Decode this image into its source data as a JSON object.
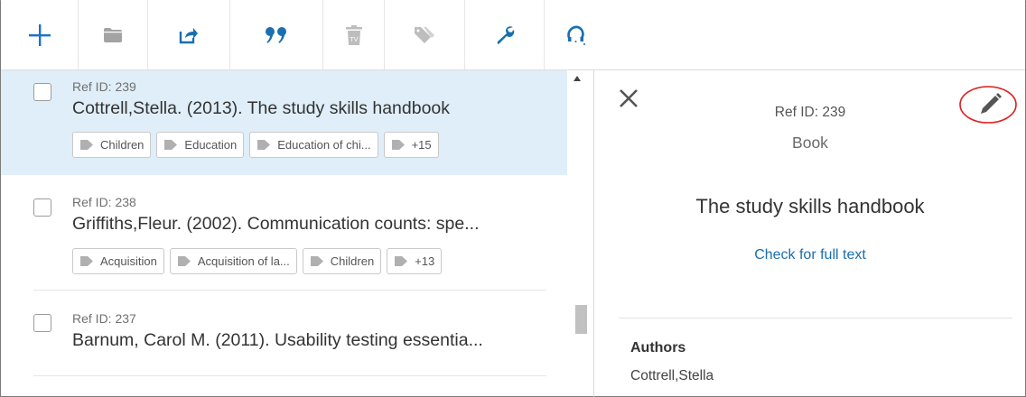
{
  "toolbar": {
    "buttons": [
      {
        "name": "add-icon",
        "color": "#1a73c8"
      },
      {
        "name": "folder-icon",
        "color": "#9e9e9e"
      },
      {
        "name": "share-icon",
        "color": "#1a6fb0"
      },
      {
        "name": "quote-icon",
        "color": "#1a6fb0"
      },
      {
        "name": "trash-icon",
        "color": "#b9b9b9"
      },
      {
        "name": "tag-icon",
        "color": "#b9b9b9"
      },
      {
        "name": "wrench-icon",
        "color": "#1a6fb0"
      },
      {
        "name": "find-duplicates-icon",
        "color": "#1a6fb0"
      }
    ]
  },
  "list": {
    "items": [
      {
        "ref_id": "Ref ID: 239",
        "title": "Cottrell,Stella. (2013). The study skills handbook",
        "selected": true,
        "tags": [
          "Children",
          "Education",
          "Education of chi...",
          "+15"
        ]
      },
      {
        "ref_id": "Ref ID: 238",
        "title": "Griffiths,Fleur. (2002). Communication counts: spe...",
        "selected": false,
        "tags": [
          "Acquisition",
          "Acquisition of la...",
          "Children",
          "+13"
        ]
      },
      {
        "ref_id": "Ref ID: 237",
        "title": "Barnum, Carol M. (2011). Usability testing essentia...",
        "selected": false,
        "tags": []
      }
    ]
  },
  "detail": {
    "ref_id": "Ref ID: 239",
    "type": "Book",
    "title": "The study skills handbook",
    "full_text_link": "Check for full text",
    "authors_label": "Authors",
    "authors_value": "Cottrell,Stella",
    "highlight_color": "#e02020"
  }
}
